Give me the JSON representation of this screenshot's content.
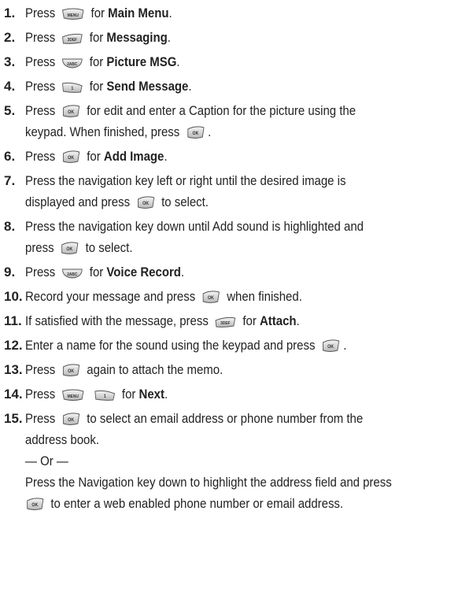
{
  "keys": {
    "menu": "MENU",
    "k3": "3DEF",
    "k2": "2ABC",
    "k1": "1",
    "ok": "OK"
  },
  "steps": [
    {
      "n": "1.",
      "press": "Press",
      "after": "for",
      "bold": "Main Menu",
      "end": "."
    },
    {
      "n": "2.",
      "press": "Press",
      "after": "for",
      "bold": "Messaging",
      "end": "."
    },
    {
      "n": "3.",
      "press": "Press",
      "after": "for",
      "bold": "Picture MSG",
      "end": "."
    },
    {
      "n": "4.",
      "press": "Press",
      "after": "for",
      "bold": "Send Message",
      "end": "."
    },
    {
      "n": "5.",
      "press": "Press",
      "t1": "for edit and enter a Caption for the picture using the",
      "t2": "keypad. When finished, press",
      "end": "."
    },
    {
      "n": "6.",
      "press": "Press",
      "after": "for",
      "bold": "Add Image",
      "end": "."
    },
    {
      "n": "7.",
      "t1": "Press the navigation key left or right until the desired image is",
      "t2": "displayed and press",
      "t3": "to select."
    },
    {
      "n": "8.",
      "t1": "Press the navigation key down until Add sound is highlighted and",
      "t2": "press",
      "t3": "to select."
    },
    {
      "n": "9.",
      "press": "Press",
      "after": "for",
      "bold": "Voice Record",
      "end": "."
    },
    {
      "n": "10.",
      "t1": "Record your message and press",
      "t2": "when finished."
    },
    {
      "n": "11.",
      "t1": "If satisfied with the message, press",
      "t2": "for",
      "bold": "Attach",
      "end": "."
    },
    {
      "n": "12.",
      "t1": "Enter a name for the sound using the keypad and press",
      "end": "."
    },
    {
      "n": "13.",
      "press": "Press",
      "t1": "again to attach the memo."
    },
    {
      "n": "14.",
      "press": "Press",
      "after": "for",
      "bold": "Next",
      "end": "."
    },
    {
      "n": "15.",
      "press": "Press",
      "t1": "to select an email address or phone number from the",
      "t2": "address book.",
      "or": "— Or —",
      "t3": "Press the Navigation key down to highlight the address field and press",
      "t4": "to enter a web enabled phone number or email address."
    }
  ]
}
